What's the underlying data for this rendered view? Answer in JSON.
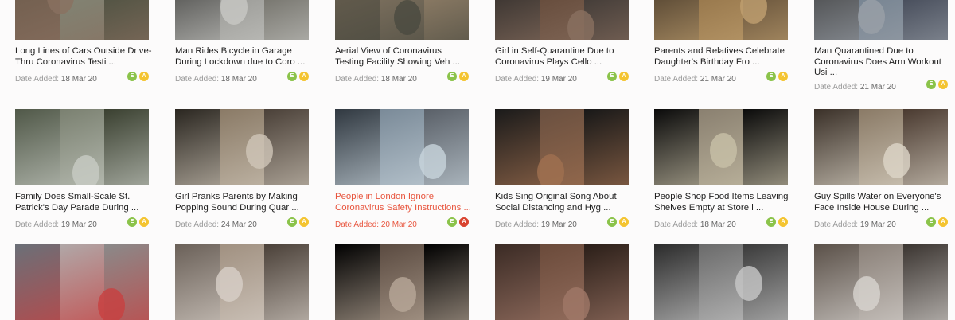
{
  "date_prefix": "Date Added:",
  "videos": [
    {
      "title": "Long Lines of Cars Outside Drive-Thru Coronavirus Testi ...",
      "date": "18 Mar 20",
      "badges": [
        "E",
        "A"
      ],
      "active": false
    },
    {
      "title": "Man Rides Bicycle in Garage During Lockdown due to Coro ...",
      "date": "18 Mar 20",
      "badges": [
        "E",
        "A"
      ],
      "active": false
    },
    {
      "title": "Aerial View of Coronavirus Testing Facility Showing Veh ...",
      "date": "18 Mar 20",
      "badges": [
        "E",
        "A"
      ],
      "active": false
    },
    {
      "title": "Girl in Self-Quarantine Due to Coronavirus Plays Cello ...",
      "date": "19 Mar 20",
      "badges": [
        "E",
        "A"
      ],
      "active": false
    },
    {
      "title": "Parents and Relatives Celebrate Daughter's Birthday Fro ...",
      "date": "21 Mar 20",
      "badges": [
        "E",
        "A"
      ],
      "active": false
    },
    {
      "title": "Man Quarantined Due to Coronavirus Does Arm Workout Usi ...",
      "date": "21 Mar 20",
      "badges": [
        "E",
        "A"
      ],
      "active": false
    },
    {
      "title": "Family Does Small-Scale St. Patrick's Day Parade During ...",
      "date": "19 Mar 20",
      "badges": [
        "E",
        "A"
      ],
      "active": false
    },
    {
      "title": "Girl Pranks Parents by Making Popping Sound During Quar ...",
      "date": "24 Mar 20",
      "badges": [
        "E",
        "A"
      ],
      "active": false
    },
    {
      "title": "People in London Ignore Coronavirus Safety Instructions ...",
      "date": "20 Mar 20",
      "badges": [
        "E",
        "A"
      ],
      "active": true
    },
    {
      "title": "Kids Sing Original Song About Social Distancing and Hyg ...",
      "date": "19 Mar 20",
      "badges": [
        "E",
        "A"
      ],
      "active": false
    },
    {
      "title": "People Shop Food Items Leaving Shelves Empty at Store i ...",
      "date": "18 Mar 20",
      "badges": [
        "E",
        "A"
      ],
      "active": false
    },
    {
      "title": "Guy Spills Water on Everyone's Face Inside House During ...",
      "date": "19 Mar 20",
      "badges": [
        "E",
        "A"
      ],
      "active": false
    },
    {
      "title": "",
      "date": "",
      "badges": [],
      "active": false
    },
    {
      "title": "",
      "date": "",
      "badges": [],
      "active": false
    },
    {
      "title": "",
      "date": "",
      "badges": [],
      "active": false
    },
    {
      "title": "",
      "date": "",
      "badges": [],
      "active": false
    },
    {
      "title": "",
      "date": "",
      "badges": [],
      "active": false
    },
    {
      "title": "",
      "date": "",
      "badges": [],
      "active": false
    }
  ]
}
